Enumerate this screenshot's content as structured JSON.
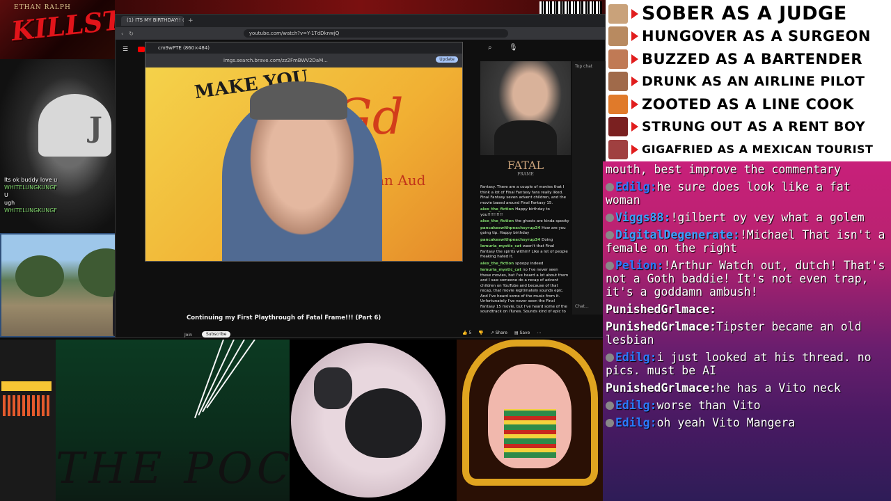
{
  "banner": {
    "name": "ETHAN RALPH",
    "logo": "KILLST"
  },
  "webcam_chat": [
    {
      "text": "Its ok buddy love u"
    },
    {
      "user": "WHITELUNGKUNGF",
      "text": ""
    },
    {
      "text": "U"
    },
    {
      "text": "ugh"
    },
    {
      "user": "WHITELUNGKUNGF",
      "text": ""
    }
  ],
  "browser": {
    "tab_title": "(1) ITS MY BIRTHDAY!! @ C",
    "url": "youtube.com/watch?v=Y-1TdDknwjQ"
  },
  "popup": {
    "tab_title": "cm9wPTE (860×484)",
    "url": "imgs.search.brave.com/zz2FmBWV2DaM...",
    "update_label": "Update",
    "sign_text": "MAKE YOU",
    "sign_sub": "istian Aud"
  },
  "video": {
    "title": "Continuing my First Playthrough of Fatal Frame!!! (Part 6)",
    "join_label": "Join",
    "subscribe_label": "Subscribe",
    "like_count": "5",
    "share_label": "Share",
    "save_label": "Save"
  },
  "side": {
    "fatal_title": "FATAL",
    "fatal_sub": "FRAME"
  },
  "ytchat": [
    {
      "text": "Fantasy. There are a couple of movies that I think a lot of Final Fantasy fans really liked. Final Fantasy seven advent children, and the movie based around Final Fantasy 15."
    },
    {
      "user": "alex_the_fiction",
      "text": "Happy birthday to you!!!!!!!!!!"
    },
    {
      "user": "alex_the_fiction",
      "text": "the ghosts are kinda spooky"
    },
    {
      "user": "pancakeswithpeachsyrup34",
      "text": "How are you going tip. Happy birthday"
    },
    {
      "user": "pancakeswithpeachsyrup34",
      "text": "Doing"
    },
    {
      "user": "lemuria_mystic_cat",
      "text": "wasn't that Final Fantasy the spirits within? Like a lot of people freaking hated it."
    },
    {
      "user": "alex_the_fiction",
      "text": "spoopy indeed"
    },
    {
      "user": "lemuria_mystic_cat",
      "text": "no I've never seen these movies, but I've heard a lot about them and I saw someone do a recap of advent children on YouTube and because of that recap, that movie legitimately sounds epic. And I've heard some of the music from it. Unfortunately I've never seen the Final Fantasy 15 movie, but I've heard some of the soundtrack on iTunes. Sounds kind of epic to be fair. Most of the music not done by the original composer, but still it was good."
    }
  ],
  "chatcol": {
    "top_label": "Top chat",
    "bottom_label": "Chat..."
  },
  "green_panel": {
    "text": "THE POCKET"
  },
  "tiers": [
    {
      "text": "SOBER AS A JUDGE",
      "color": "#c9a27a",
      "size": 27
    },
    {
      "text": "HUNGOVER AS A SURGEON",
      "color": "#b88a60",
      "size": 21
    },
    {
      "text": "BUZZED AS A BARTENDER",
      "color": "#c07a55",
      "size": 21
    },
    {
      "text": "DRUNK AS AN AIRLINE PILOT",
      "color": "#a06a4a",
      "size": 19
    },
    {
      "text": "ZOOTED AS A LINE COOK",
      "color": "#e07a2a",
      "size": 21
    },
    {
      "text": "STRUNG OUT AS A RENT BOY",
      "color": "#7a2020",
      "size": 19
    },
    {
      "text": "GIGAFRIED AS A MEXICAN TOURIST",
      "color": "#a04040",
      "size": 16
    }
  ],
  "chat": [
    {
      "user": "",
      "text": "mouth, best improve the commentary",
      "color": "#ffffff"
    },
    {
      "user": "Edilg:",
      "text": "he sure does look like a fat woman",
      "color": "#2b7bff"
    },
    {
      "user": "Viggs88:",
      "text": "!gilbert oy vey what a golem",
      "color": "#3aa0ff"
    },
    {
      "user": "DigitalDegenerate:",
      "text": "!Michael That isn't a female on the right",
      "color": "#3aa0ff"
    },
    {
      "user": "Pelion:",
      "text": "!Arthur Watch out, dutch! That's not a Goth baddie! It's not even trap, it's a goddamn ambush!",
      "color": "#2b7bff"
    },
    {
      "user": "PunishedGrlmace:",
      "text": "",
      "color": "#ffffff"
    },
    {
      "user": "PunishedGrlmace:",
      "text": "Tipster became an old lesbian",
      "color": "#ffffff"
    },
    {
      "user": "Edilg:",
      "text": "i just looked at his thread. no pics. must be AI",
      "color": "#2b7bff"
    },
    {
      "user": "PunishedGrlmace:",
      "text": "he has a Vito neck",
      "color": "#ffffff"
    },
    {
      "user": "Edilg:",
      "text": "worse than Vito",
      "color": "#2b7bff"
    },
    {
      "user": "Edilg:",
      "text": "oh yeah Vito Mangera",
      "color": "#2b7bff"
    }
  ]
}
